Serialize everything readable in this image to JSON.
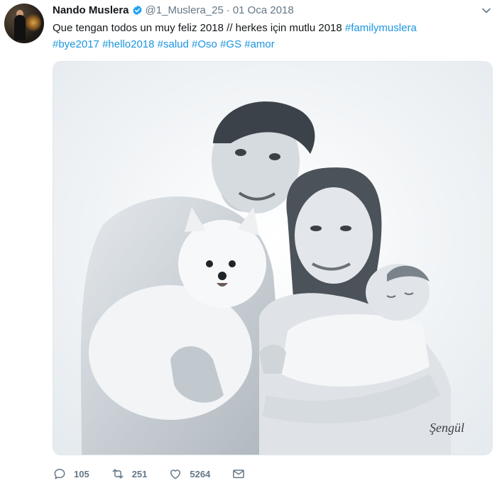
{
  "tweet": {
    "author_name": "Nando Muslera",
    "handle": "@1_Muslera_25",
    "separator": "·",
    "date": "01 Oca 2018",
    "text_plain": "Que tengan todos un muy feliz 2018 // herkes için mutlu 2018 ",
    "hashtags": [
      "#familymuslera",
      "#bye2017",
      "#hello2018",
      "#salud",
      "#Oso",
      "#GS",
      "#amor"
    ],
    "image_signature": "Şengül",
    "reply_count": "105",
    "retweet_count": "251",
    "like_count": "5264"
  },
  "icons": {
    "verified": "verified-badge-icon",
    "more": "chevron-down-icon",
    "reply": "reply-icon",
    "retweet": "retweet-icon",
    "like": "heart-icon",
    "dm": "envelope-icon"
  },
  "colors": {
    "link": "#1b95e0",
    "secondary_text": "#657786",
    "verified": "#1da1f2"
  }
}
